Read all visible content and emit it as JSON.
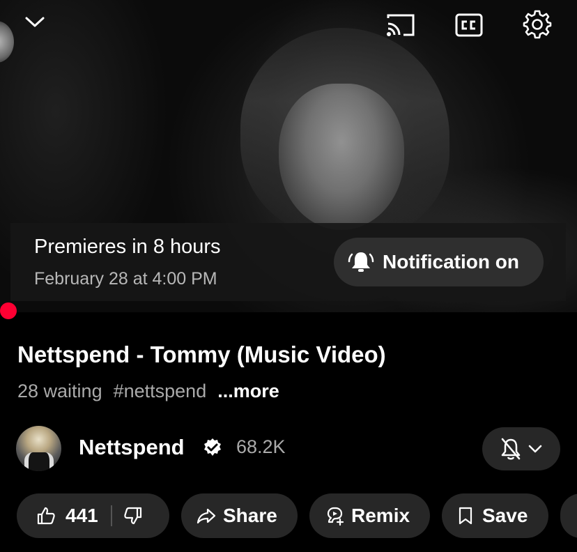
{
  "player": {
    "icons": {
      "collapse": "chevron-down-icon",
      "cast": "cast-icon",
      "captions": "closed-captions-icon",
      "settings": "gear-icon"
    },
    "premiere": {
      "title": "Premieres in 8 hours",
      "date": "February 28 at 4:00 PM",
      "notification_label": "Notification on",
      "notification_icon": "bell-ringing-icon"
    },
    "progress_color": "#ff0033"
  },
  "video": {
    "title": "Nettspend - Tommy (Music Video)",
    "waiting": "28 waiting",
    "hashtag": "#nettspend",
    "more": "...more"
  },
  "channel": {
    "name": "Nettspend",
    "verified_icon": "verified-badge-icon",
    "subscribers": "68.2K",
    "bell_icon": "bell-off-icon"
  },
  "actions": {
    "likes": "441",
    "share": "Share",
    "remix": "Remix",
    "save": "Save"
  }
}
